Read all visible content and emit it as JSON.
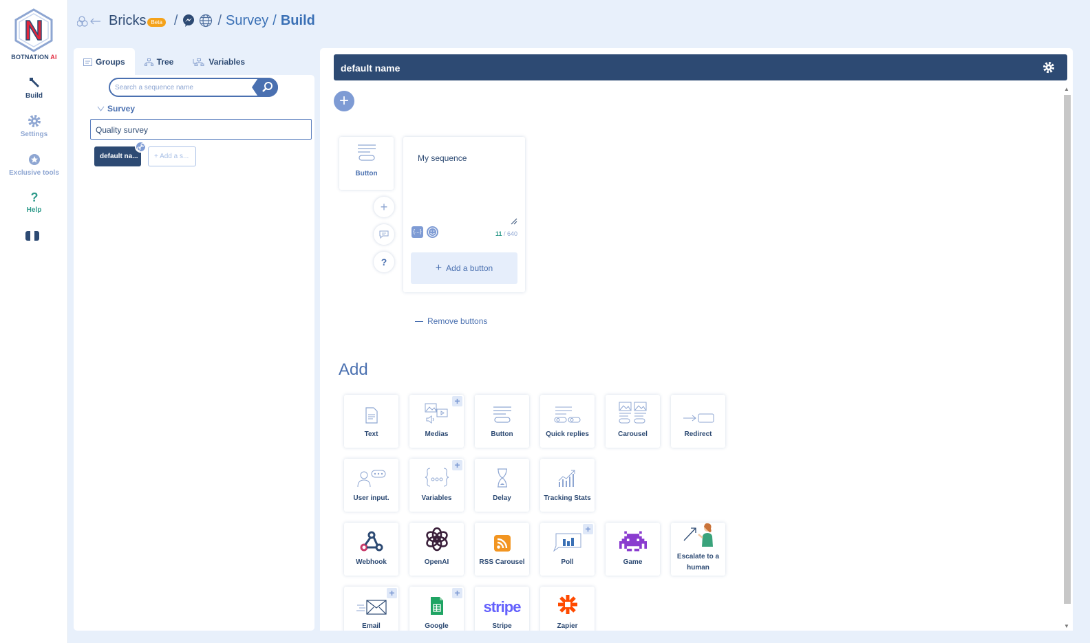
{
  "brand": {
    "name_a": "BOTNATION",
    "name_b": " AI"
  },
  "nav": {
    "build": "Build",
    "settings": "Settings",
    "tools": "Exclusive tools",
    "help": "Help"
  },
  "header": {
    "bricks": "Bricks",
    "beta": "Beta",
    "sep": "/",
    "survey": "Survey",
    "build": "Build"
  },
  "left_tabs": {
    "groups": "Groups",
    "tree": "Tree",
    "variables": "Variables"
  },
  "search": {
    "placeholder": "Search a sequence name"
  },
  "group": {
    "label": "Survey",
    "sequence_name": "Quality survey"
  },
  "chips": {
    "active": "default na...",
    "add": "Add a s..."
  },
  "main": {
    "title": "default name",
    "button_card": "Button",
    "sequence_text": "My sequence",
    "char_count": "11",
    "char_max": "/ 640",
    "add_button": "Add a button",
    "remove_buttons": "Remove buttons",
    "add_heading": "Add"
  },
  "add_tiles": {
    "text": "Text",
    "medias": "Medias",
    "button": "Button",
    "quick_replies": "Quick replies",
    "carousel": "Carousel",
    "redirect": "Redirect",
    "user_input": "User input.",
    "variables": "Variables",
    "delay": "Delay",
    "tracking": "Tracking Stats",
    "webhook": "Webhook",
    "openai": "OpenAI",
    "rss": "RSS Carousel",
    "poll": "Poll",
    "game": "Game",
    "escalate": "Escalate to a human",
    "email": "Email",
    "google": "Google",
    "stripe": "Stripe",
    "stripe_logo": "stripe",
    "zapier": "Zapier"
  },
  "colors": {
    "navy": "#2d4a73",
    "accent": "#4a70b0",
    "teal": "#2e9a8a",
    "beta": "#f4a21a"
  }
}
